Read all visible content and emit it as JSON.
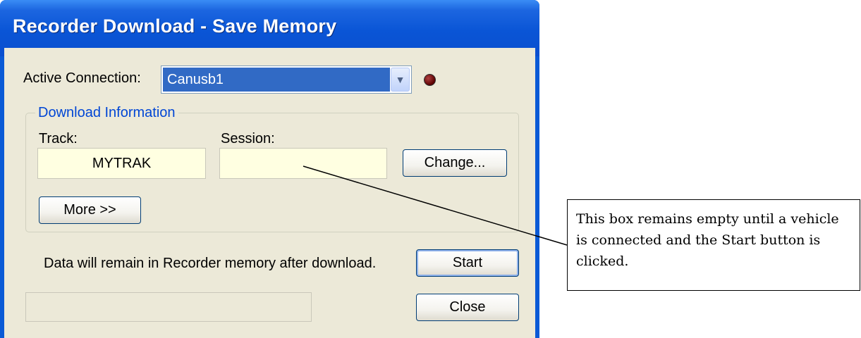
{
  "window": {
    "title": "Recorder Download - Save Memory"
  },
  "connection": {
    "label": "Active Connection:",
    "selected": "Canusb1",
    "status_led_color": "#6b0000"
  },
  "download_info": {
    "group_title": "Download Information",
    "track_label": "Track:",
    "track_value": "MYTRAK",
    "session_label": "Session:",
    "session_value": "",
    "change_button": "Change...",
    "more_button": "More >>"
  },
  "status_message": "Data will remain in Recorder memory after download.",
  "buttons": {
    "start": "Start",
    "close": "Close"
  },
  "callout": {
    "text": "This box remains empty until a vehicle is connected and the Start button is clicked."
  }
}
